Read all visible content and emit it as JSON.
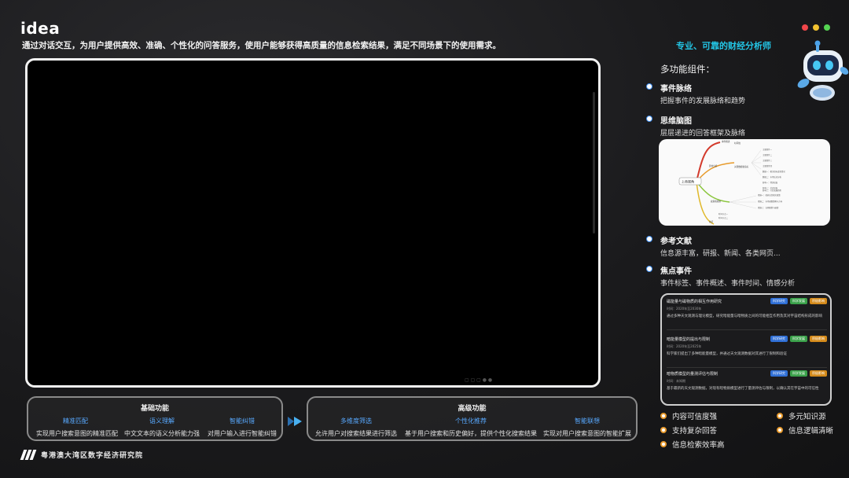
{
  "header": {
    "logo": "idea",
    "subtitle": "通过对话交互，为用户提供高效、准确、个性化的问答服务，使用户能够获得高质量的信息检索结果，满足不同场景下的使用需求。",
    "window_dots": [
      "#f0464a",
      "#f2c230",
      "#55d452"
    ]
  },
  "right": {
    "tagline": "专业、可靠的财经分析师",
    "components_title": "多功能组件：",
    "components": [
      {
        "title": "事件脉络",
        "desc": "把握事件的发展脉络和趋势"
      },
      {
        "title": "思维脑图",
        "desc": "层层递进的回答框架及脉络"
      },
      {
        "title": "参考文献",
        "desc": "信息源丰富，研报、新闻、各类网页..."
      },
      {
        "title": "焦点事件",
        "desc": "事件标签、事件概述、事件时间、情感分析"
      }
    ],
    "mindmap": {
      "root": "上帝视角",
      "branches": [
        "事件概述",
        "关键数据和指标",
        "影响分析",
        "政策和措施",
        "时间线",
        "总结"
      ],
      "leaves": [
        "主要事件一",
        "主要事件二",
        "主要事件三",
        "主要事件四",
        "数据一：相关指标变化情况",
        "数据二：市场反应分析",
        "影响一：经济层面",
        "影响二：社会层面",
        "影响三：行业发展趋势",
        "措施一：政府出台相关政策",
        "措施二：市场调整策略与方向",
        "措施三：长期规划与展望",
        "时间节点一",
        "时间节点二"
      ]
    },
    "events": [
      {
        "title": "磁能量与磁物质的相互作用研究",
        "meta": "时间：2020年至2030年",
        "desc": "通过多种天文观测与理论模型，研究暗能量与暗物质之间的可能相互作用及其对宇宙结构形成的影响",
        "tags": [
          {
            "label": "科学研究",
            "color": "#2f6fd6"
          },
          {
            "label": "科学发展",
            "color": "#3aa14a"
          },
          {
            "label": "积极影响",
            "color": "#d48a1a"
          }
        ]
      },
      {
        "title": "暗能量模型的提出与限制",
        "meta": "时间：2020年至2025年",
        "desc": "科学家们提出了多种暗能量模型，并通过天文观测数据对其进行了限制和验证",
        "tags": [
          {
            "label": "科学研究",
            "color": "#2f6fd6"
          },
          {
            "label": "科学发展",
            "color": "#3aa14a"
          },
          {
            "label": "积极影响",
            "color": "#d48a1a"
          }
        ]
      },
      {
        "title": "暗物质模型的量测评估与限制",
        "meta": "时间：未知期",
        "desc": "基于最新的天文观测数据，对现有暗物质模型进行了量测评估与限制，以确认其在宇宙中的可信性",
        "tags": [
          {
            "label": "科学研究",
            "color": "#2f6fd6"
          },
          {
            "label": "科学发展",
            "color": "#3aa14a"
          },
          {
            "label": "积极影响",
            "color": "#d48a1a"
          }
        ]
      }
    ],
    "features": [
      "内容可信度强",
      "多元知识源",
      "支持复杂回答",
      "信息逻辑清晰",
      "信息检索效率高"
    ]
  },
  "bottom": {
    "basic": {
      "title": "基础功能",
      "items": [
        {
          "name": "精准匹配",
          "desc": "实现用户搜索意图的精准匹配"
        },
        {
          "name": "语义理解",
          "desc": "中文文本的语义分析能力强"
        },
        {
          "name": "智能纠错",
          "desc": "对用户输入进行智能纠错"
        }
      ]
    },
    "advanced": {
      "title": "高级功能",
      "items": [
        {
          "name": "多维度筛选",
          "desc": "允许用户对搜索结果进行筛选"
        },
        {
          "name": "个性化推荐",
          "desc": "基于用户搜索和历史偏好，提供个性化搜索结果"
        },
        {
          "name": "智能联想",
          "desc": "实现对用户搜索意图的智能扩展"
        }
      ]
    }
  },
  "org": "粤港澳大湾区数字经济研究院",
  "accent_color": "#23c6e6"
}
